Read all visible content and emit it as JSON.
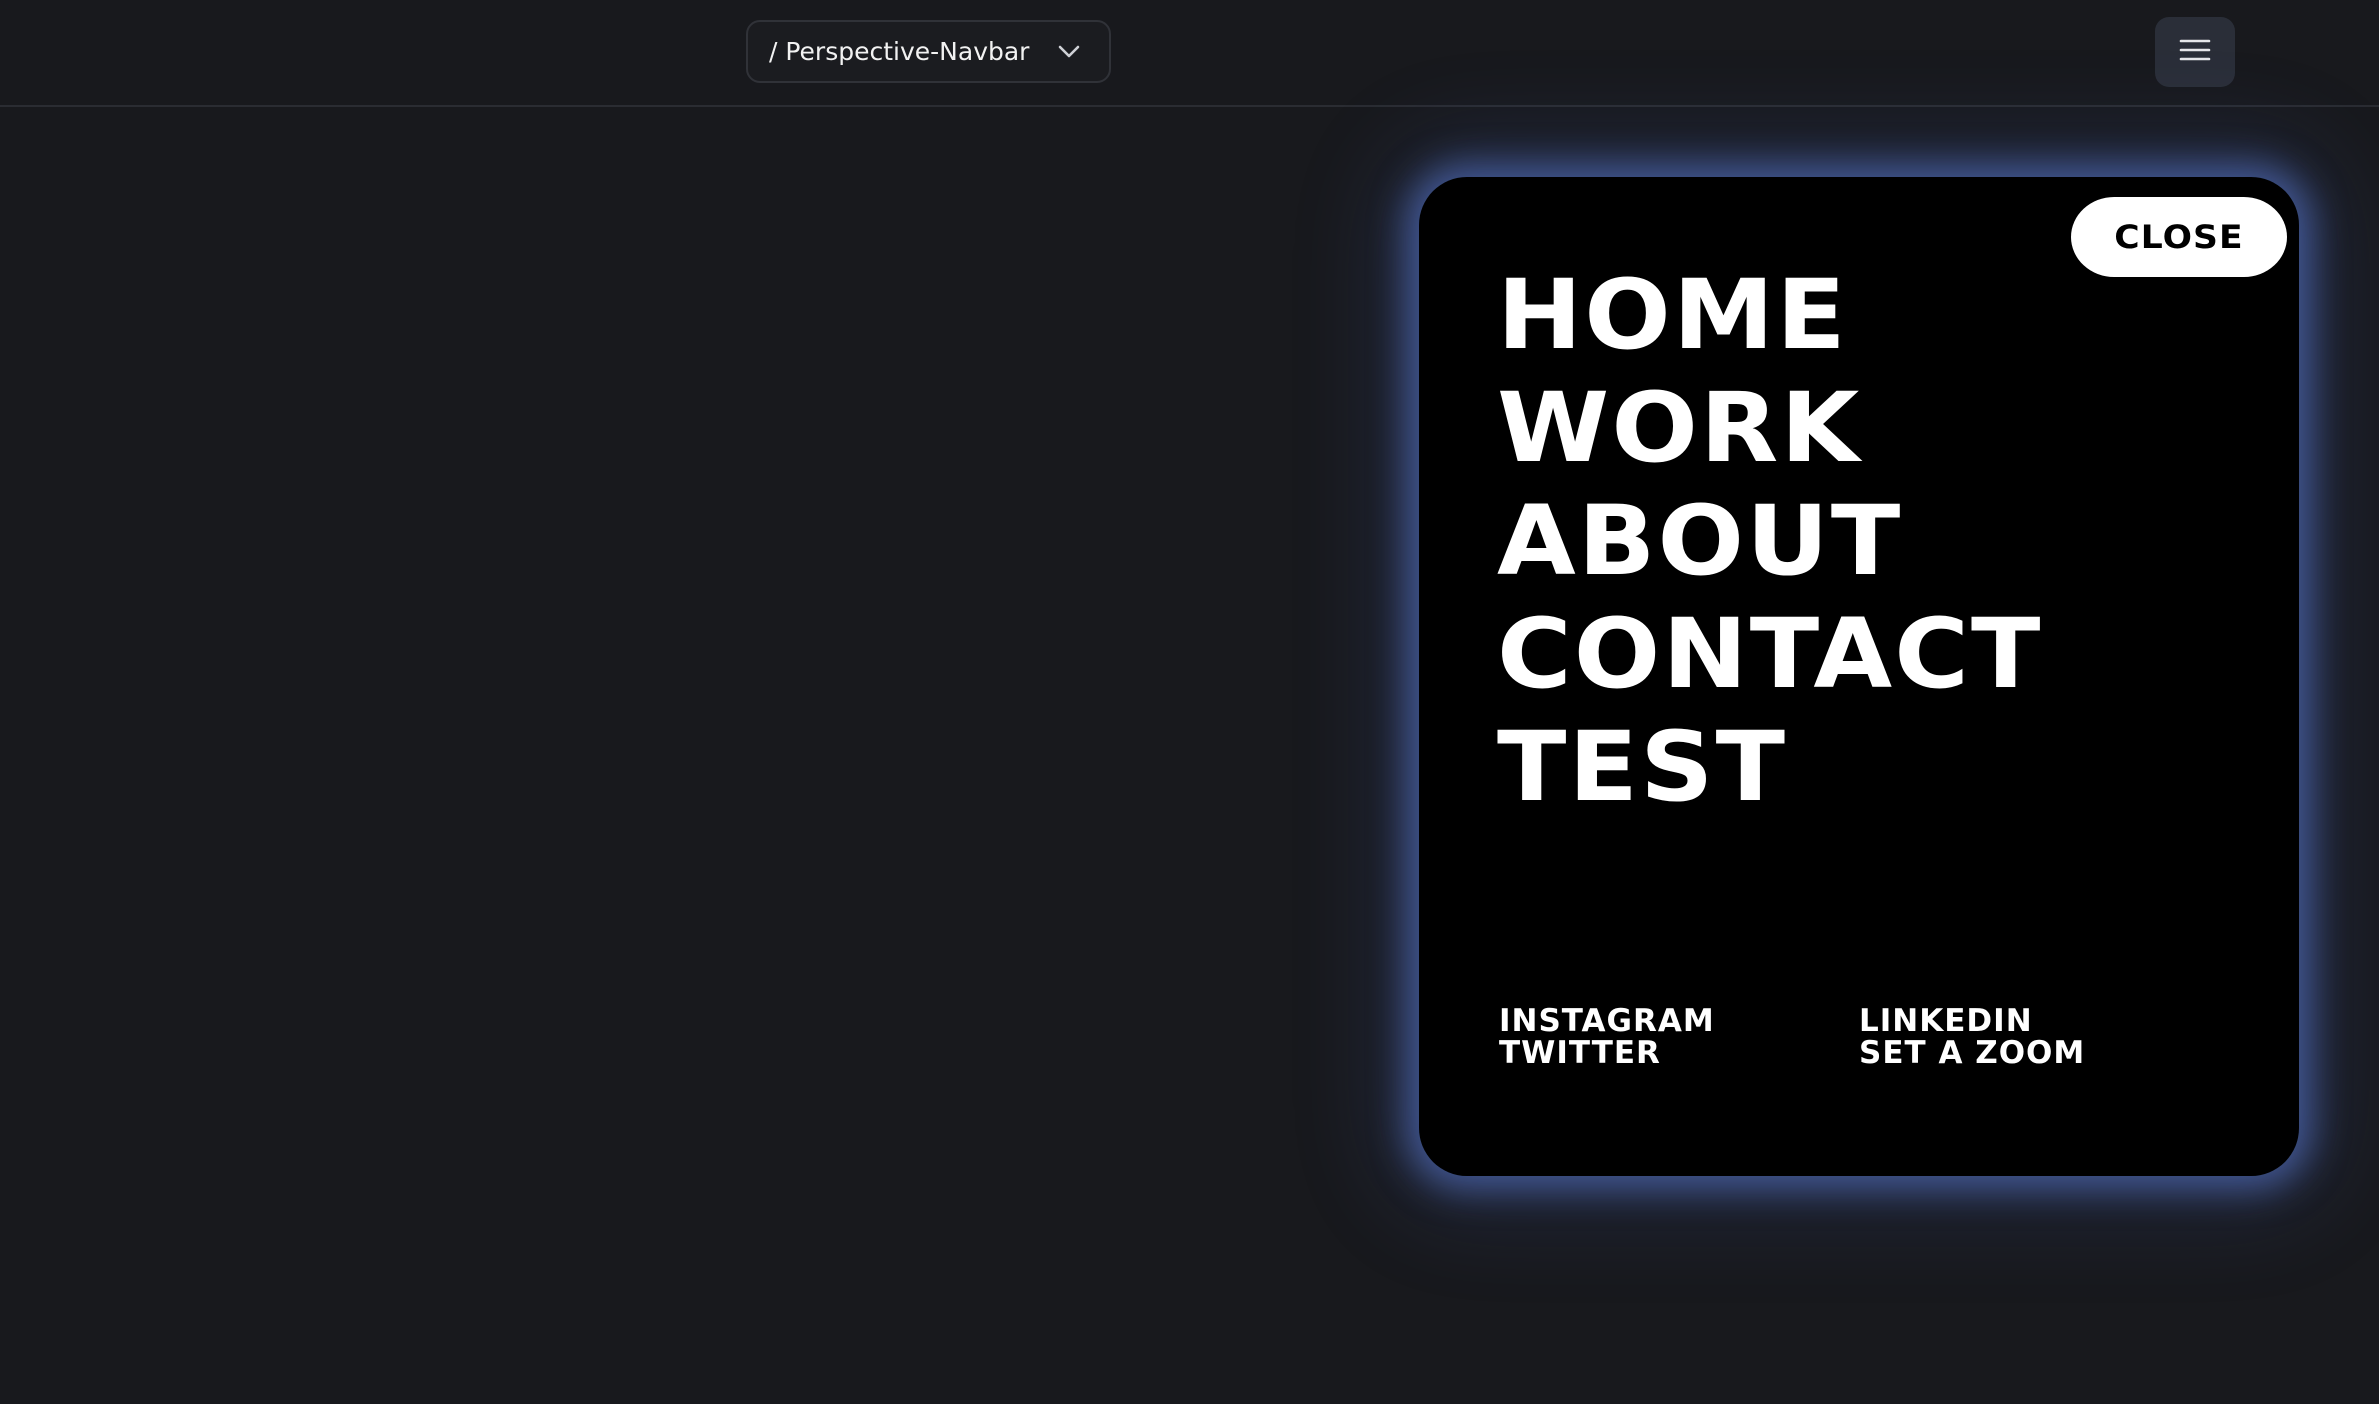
{
  "topbar": {
    "route_label": "/ Perspective-Navbar",
    "route_icon": "chevron-down-icon",
    "menu_icon": "hamburger-menu-icon"
  },
  "menu": {
    "close_label": "CLOSE",
    "links": [
      "HOME",
      "WORK",
      "ABOUT",
      "CONTACT",
      "TEST"
    ],
    "social_left": [
      "INSTAGRAM",
      "TWITTER"
    ],
    "social_right": [
      "LINKEDIN",
      "SET A ZOOM"
    ]
  },
  "colors": {
    "background": "#18191d",
    "panel": "#000000",
    "glow": "#5c7fdc",
    "text": "#ffffff"
  }
}
